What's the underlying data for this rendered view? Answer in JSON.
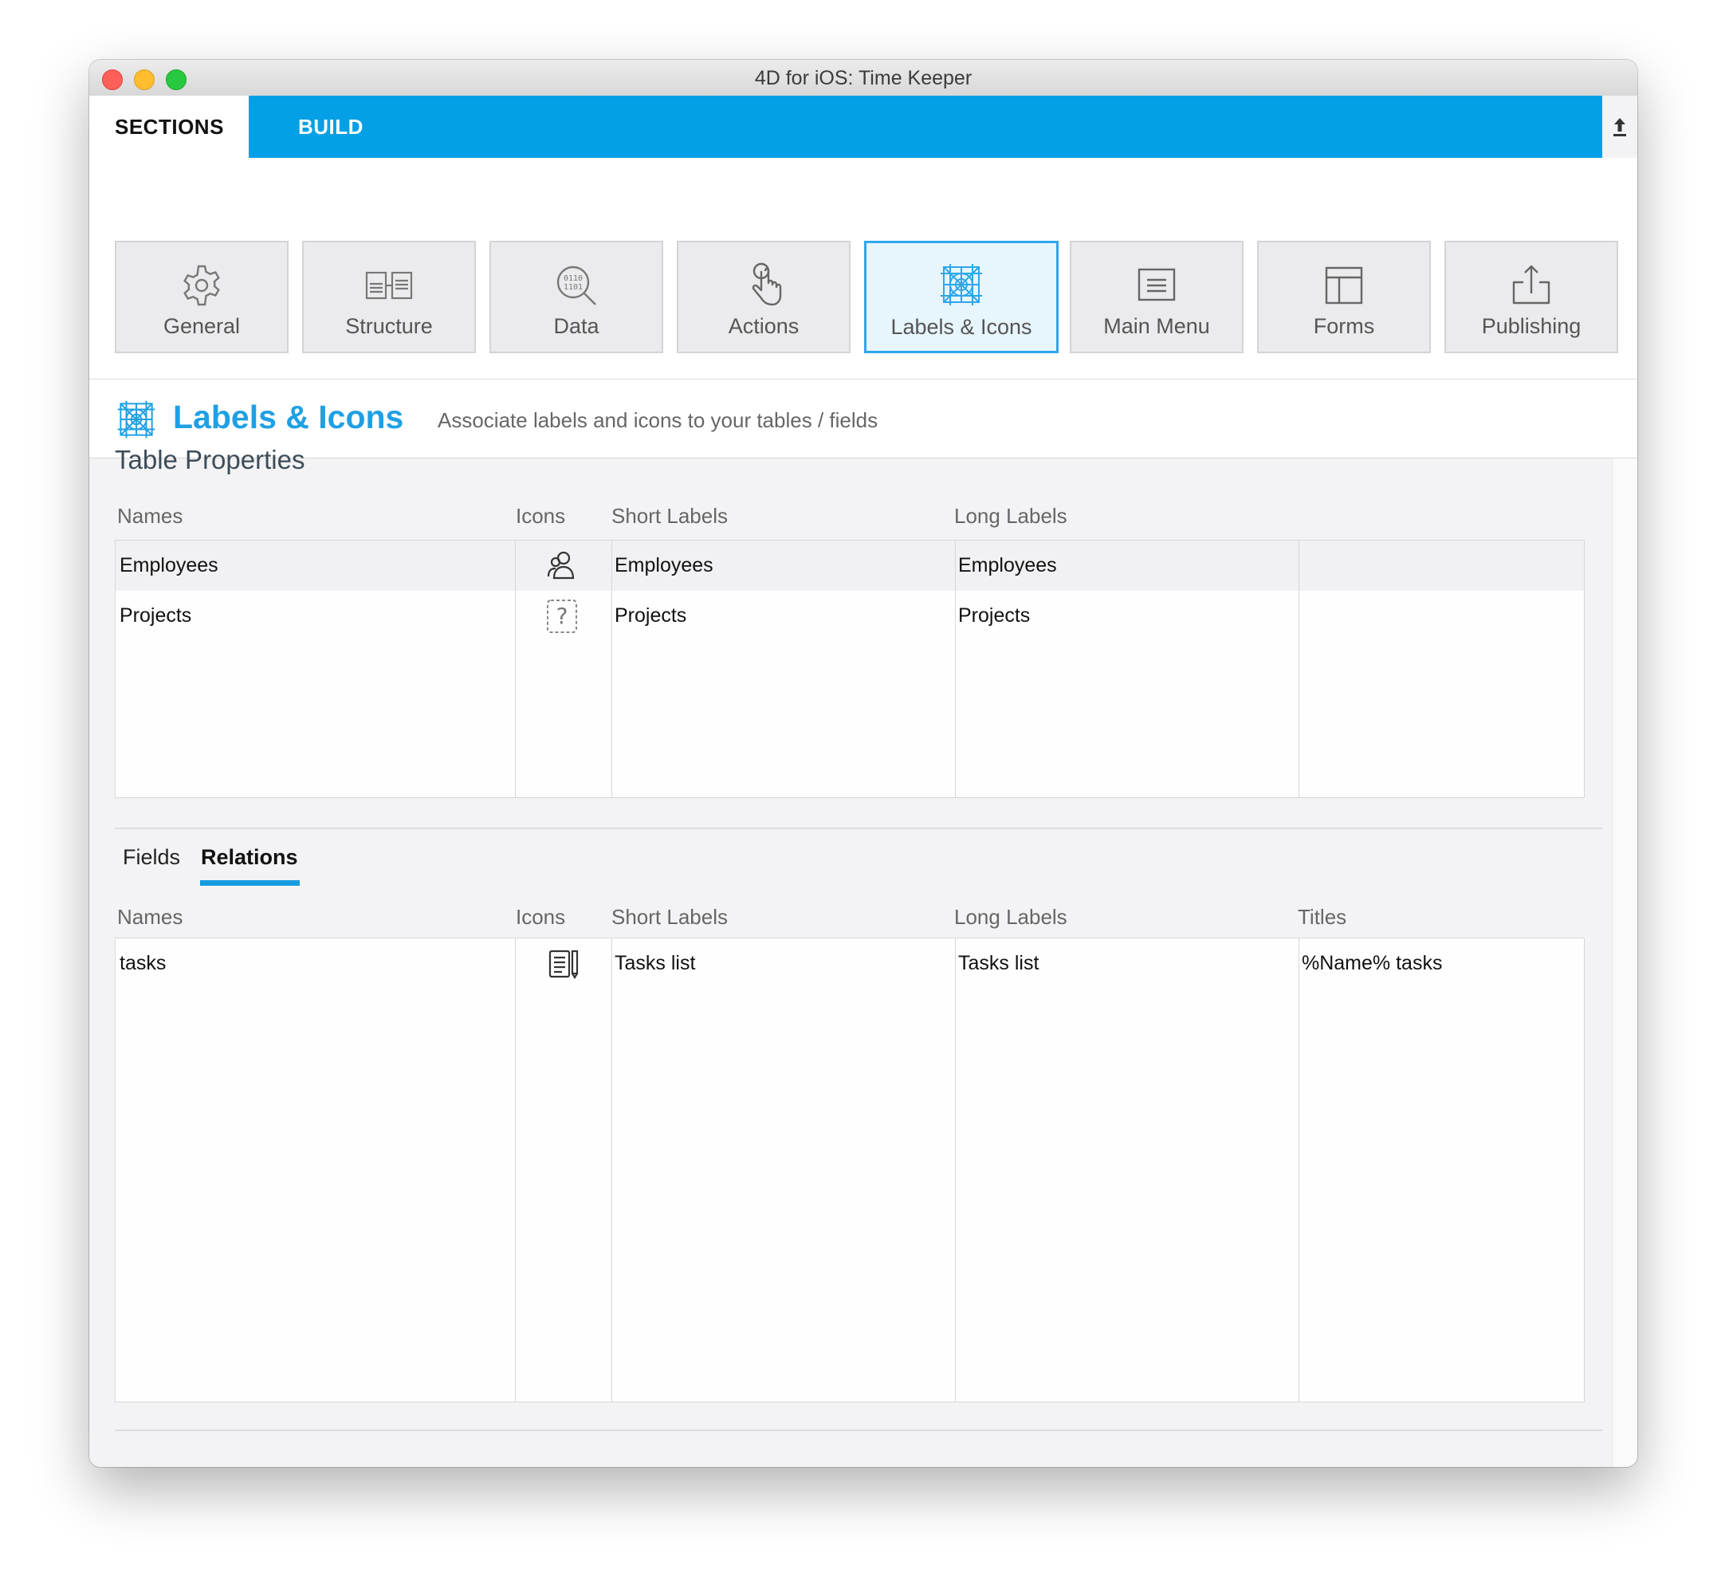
{
  "window": {
    "title": "4D for iOS: Time Keeper"
  },
  "tabs": {
    "sections": "SECTIONS",
    "build": "BUILD"
  },
  "sections": [
    {
      "label": "General",
      "icon": "gear-icon"
    },
    {
      "label": "Structure",
      "icon": "structure-icon"
    },
    {
      "label": "Data",
      "icon": "data-search-icon"
    },
    {
      "label": "Actions",
      "icon": "tap-gesture-icon"
    },
    {
      "label": "Labels & Icons",
      "icon": "labels-icons-icon",
      "active": true
    },
    {
      "label": "Main Menu",
      "icon": "menu-icon"
    },
    {
      "label": "Forms",
      "icon": "forms-layout-icon"
    },
    {
      "label": "Publishing",
      "icon": "publish-upload-icon"
    }
  ],
  "header": {
    "title": "Labels & Icons",
    "description": "Associate labels and icons to your tables / fields"
  },
  "table_properties": {
    "title": "Table Properties",
    "columns": {
      "names": "Names",
      "icons": "Icons",
      "short": "Short Labels",
      "long": "Long Labels"
    },
    "rows": [
      {
        "name": "Employees",
        "icon": "people-icon",
        "short": "Employees",
        "long": "Employees"
      },
      {
        "name": "Projects",
        "icon": "unknown-question-icon",
        "short": "Projects",
        "long": "Projects"
      }
    ]
  },
  "subtabs": {
    "fields": "Fields",
    "relations": "Relations"
  },
  "relations": {
    "columns": {
      "names": "Names",
      "icons": "Icons",
      "short": "Short Labels",
      "long": "Long Labels",
      "titles": "Titles"
    },
    "rows": [
      {
        "name": "tasks",
        "icon": "task-list-icon",
        "short": "Tasks list",
        "long": "Tasks list",
        "title": "%Name% tasks"
      }
    ]
  },
  "colors": {
    "accent": "#04a0e5",
    "title_blue": "#1fa0e4",
    "active_border": "#2ea6ec"
  }
}
